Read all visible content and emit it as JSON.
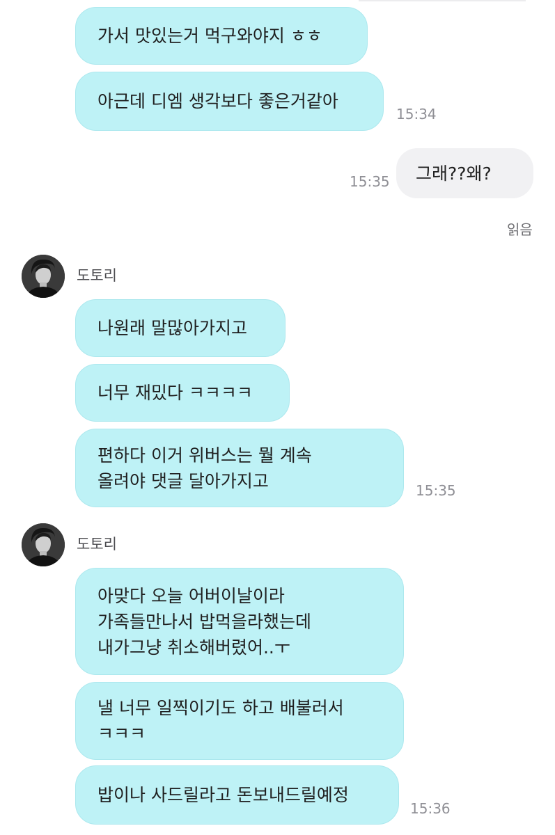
{
  "chat": {
    "read_label": "읽음",
    "messages": [
      {
        "lines": [
          "가서 맛있는거 먹구와야지 ㅎㅎ"
        ]
      },
      {
        "lines": [
          "아근데 디엠 생각보다 좋은거같아"
        ],
        "time": "15:34"
      },
      {
        "lines": [
          "그래??왜?"
        ],
        "time": "15:35",
        "outgoing": true
      },
      {
        "sender": "도토리"
      },
      {
        "lines": [
          "나원래 말많아가지고"
        ]
      },
      {
        "lines": [
          "너무 재밌다 ㅋㅋㅋㅋ"
        ]
      },
      {
        "lines": [
          "편하다 이거 위버스는 뭘 계속",
          "올려야 댓글 달아가지고"
        ],
        "time": "15:35"
      },
      {
        "sender": "도토리"
      },
      {
        "lines": [
          "아맞다 오늘 어버이날이라",
          "가족들만나서 밥먹을라했는데",
          "내가그냥 취소해버렸어..ㅜ"
        ]
      },
      {
        "lines": [
          "낼 너무 일찍이기도 하고 배불러서",
          "ㅋㅋㅋ"
        ]
      },
      {
        "lines": [
          "밥이나 사드릴라고 돈보내드릴예정"
        ],
        "time": "15:36"
      }
    ]
  },
  "colors": {
    "incoming_bubble": "#bef2f6",
    "incoming_border": "#ace8ee",
    "outgoing_bubble": "#f1f1f3",
    "time_text": "#8f8f95"
  },
  "icons": {
    "avatar": "profile-photo"
  }
}
